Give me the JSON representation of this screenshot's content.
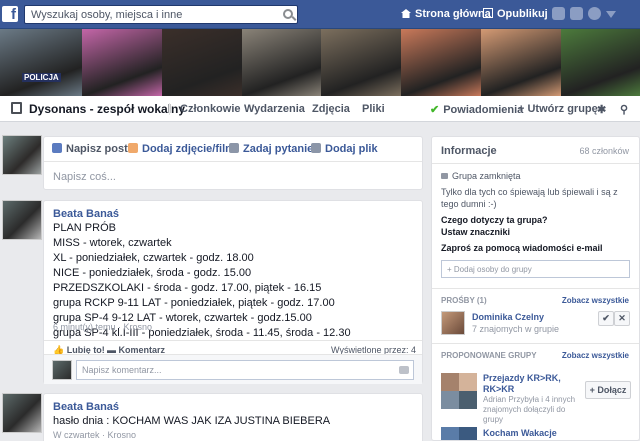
{
  "header": {
    "search_placeholder": "Wyszukaj osoby, miejsca i inne",
    "home_label": "Strona główna",
    "publish_label": "Opublikuj"
  },
  "cover": {
    "tiles": [
      {
        "w": 82,
        "c": "#6b7a86"
      },
      {
        "w": 80,
        "c": "#c466a8"
      },
      {
        "w": 80,
        "c": "#3b2f2a"
      },
      {
        "w": 79,
        "c": "#8a8378"
      },
      {
        "w": 80,
        "c": "#7c6f5e"
      },
      {
        "w": 80,
        "c": "#c9795a"
      },
      {
        "w": 80,
        "c": "#d49a74"
      },
      {
        "w": 79,
        "c": "#4c7a3c"
      }
    ],
    "badge": "POLICJA"
  },
  "group": {
    "name": "Dysonans - zespół wokalny",
    "tabs": [
      "Członkowie",
      "Wydarzenia",
      "Zdjęcia",
      "Pliki"
    ],
    "notifications": "Powiadomienia",
    "create_group": "+ Utwórz grupę"
  },
  "composer": {
    "tabs": [
      "Napisz post",
      "Dodaj zdjęcie/film",
      "Zadaj pytanie",
      "Dodaj plik"
    ],
    "placeholder": "Napisz coś..."
  },
  "posts": [
    {
      "author": "Beata Banaś",
      "lines": [
        "PLAN PRÓB",
        "MISS - wtorek, czwartek",
        "XL - poniedziałek, czwartek - godz. 18.00",
        "NICE - poniedziałek, środa - godz. 15.00",
        "PRZEDSZKOLAKI - środa - godz. 17.00, piątek - 16.15",
        "grupa RCKP 9-11 LAT - poniedziałek, piątek - godz. 17.00",
        "grupa SP-4 9-12 LAT - wtorek, czwartek - godz.15.00",
        "grupa SP-4 kl.I-III - poniedziałek, środa - 11.45, środa - 12.30"
      ],
      "meta": "6 minut(y) temu · Krosno",
      "like": "Lubię to!",
      "comment": "Komentarz",
      "seen": "Wyświetlone przez: 4",
      "comment_placeholder": "Napisz komentarz..."
    },
    {
      "author": "Beata Banaś",
      "lines": [
        "hasło dnia : KOCHAM WAS JAK IZA JUSTINA BIEBERA"
      ],
      "meta": "W czwartek · Krosno"
    }
  ],
  "sidebar": {
    "title": "Informacje",
    "members": "68 członków",
    "closed": "Grupa zamknięta",
    "desc": "Tylko dla tych co śpiewają lub śpiewali i są z tego dumni :-)",
    "about_q": "Czego dotyczy ta grupa?",
    "tags": "Ustaw znaczniki",
    "invite": "Zaproś za pomocą wiadomości e-mail",
    "add_placeholder": "+ Dodaj osoby do grupy",
    "requests_title": "PROŚBY (1)",
    "see_all": "Zobacz wszystkie",
    "request_name": "Dominika Czelny",
    "request_sub": "7 znajomych w grupie",
    "suggested_title": "PROPONOWANE GRUPY",
    "suggested_name": "Przejazdy KR>RK, RK>KR",
    "suggested_sub": "Adrian Przybyła i 4 innych znajomych dołączyli do grupy",
    "join": "+ Dołącz",
    "next_group": "Kocham Wakacje"
  },
  "colors": {
    "brand": "#3b5998",
    "background": "#e9eaed",
    "link": "#3b5998",
    "check": "#42b72a"
  }
}
